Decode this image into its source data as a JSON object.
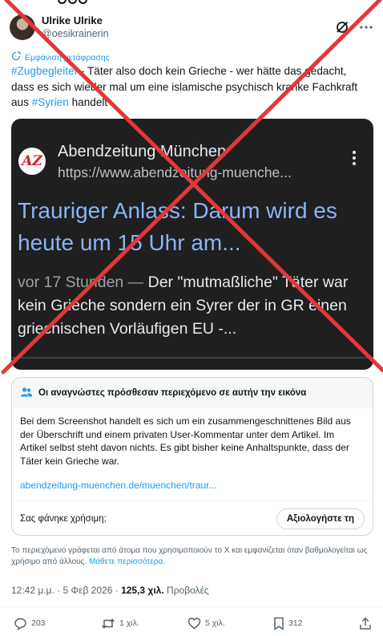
{
  "author": {
    "display_name": "Ulrike Ulrike",
    "handle": "@oesikrainerin"
  },
  "translate_label": "Εμφάνιση μετάφρασης",
  "tweet": {
    "hashtag1": "#Zugbegleiter",
    "part1": " - Täter also doch kein Grieche - wer hätte das gedacht, dass es sich wieder mal um eine islamische psychisch kranke Fachkraft aus ",
    "hashtag2": "#Syrien",
    "part2": " handelt"
  },
  "media": {
    "logo_text": "AZ",
    "site_name": "Abendzeitung München",
    "site_url": "https://www.abendzeitung-muenche...",
    "headline": "Trauriger Anlass: Darum wird es heute um 15 Uhr am...",
    "age": "vor 17 Stunden — ",
    "snippet": "Der \"mutmaßliche\" Täter war kein Grieche sondern ein Syrer der in GR einen griechischen Vorläufigen EU -..."
  },
  "note": {
    "title": "Οι αναγνώστες πρόσθεσαν περιεχόμενο σε αυτήν την εικόνα",
    "body": "Bei dem Screenshot handelt es sich um ein zusammengeschnittenes Bild aus der Überschrift und einem privaten User-Kommentar unter dem Artikel. Im Artikel selbst steht davon nichts. Es gibt bisher keine Anhaltspunkte, dass der Täter kein Grieche war.",
    "link": "abendzeitung-muenchen.de/muenchen/traur...",
    "helpful_question": "Σας φάνηκε χρήσιμη;",
    "rate_button": "Αξιολογήστε τη"
  },
  "disclaimer": {
    "text": "Το περιεχόμενο γράφεται από άτομα που χρησιμοποιούν το X και εμφανίζεται όταν βαθμολογείται ως χρήσιμο από άλλους. ",
    "more": "Μάθετε περισσότερα."
  },
  "meta": {
    "time_date": "12:42 μ.μ. · 5 Φεβ 2026 · ",
    "views_count": "125,3 χιλ.",
    "views_label": " Προβολές"
  },
  "actions": {
    "replies": "203",
    "reposts": "1 χιλ.",
    "likes": "5 χιλ.",
    "bookmarks": "312"
  },
  "colors": {
    "accent": "#1d9bf0",
    "cross": "#e0383b",
    "card_bg": "#1f1f1f",
    "headline": "#8ab4f8"
  }
}
